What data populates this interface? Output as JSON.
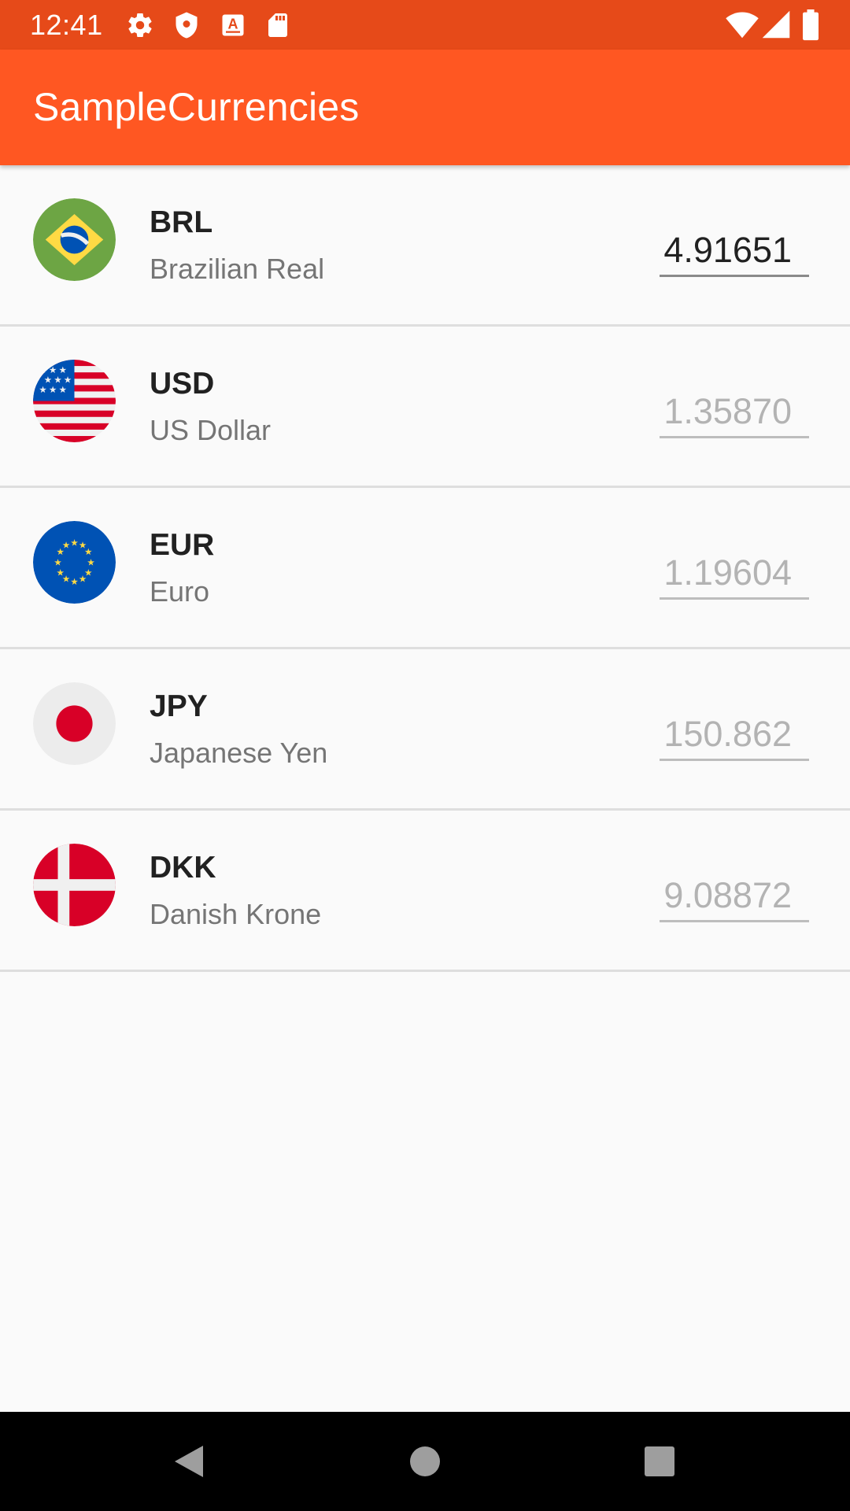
{
  "status_bar": {
    "time": "12:41",
    "left_icons": [
      "gear-icon",
      "shield-icon",
      "a-badge-icon",
      "sd-card-icon"
    ],
    "right_icons": [
      "wifi-icon",
      "signal-icon",
      "battery-icon"
    ]
  },
  "app_bar": {
    "title": "SampleCurrencies",
    "color": "#ff5722"
  },
  "currencies": [
    {
      "code": "BRL",
      "name": "Brazilian Real",
      "value": "4.91651",
      "placeholder": "",
      "flag": "brazil-flag-icon"
    },
    {
      "code": "USD",
      "name": "US Dollar",
      "value": "",
      "placeholder": "1.35870",
      "flag": "usa-flag-icon"
    },
    {
      "code": "EUR",
      "name": "Euro",
      "value": "",
      "placeholder": "1.19604",
      "flag": "eu-flag-icon"
    },
    {
      "code": "JPY",
      "name": "Japanese Yen",
      "value": "",
      "placeholder": "150.862",
      "flag": "japan-flag-icon"
    },
    {
      "code": "DKK",
      "name": "Danish Krone",
      "value": "",
      "placeholder": "9.08872",
      "flag": "denmark-flag-icon"
    }
  ],
  "nav_bar": {
    "buttons": [
      "back-icon",
      "home-icon",
      "recents-icon"
    ]
  }
}
